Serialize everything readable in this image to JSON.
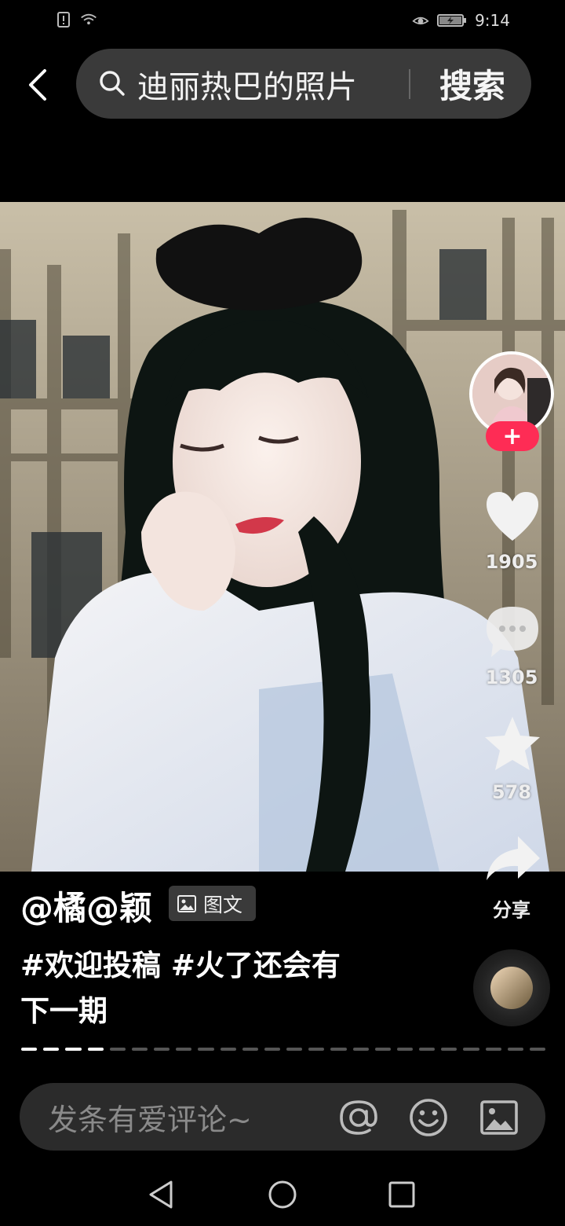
{
  "status_bar": {
    "time": "9:14",
    "icons": [
      "sim-alert-icon",
      "wifi-icon",
      "eye-comfort-icon",
      "battery-charging-icon"
    ]
  },
  "search": {
    "query": "迪丽热巴的照片",
    "button_label": "搜索"
  },
  "post": {
    "author": "@橘@颖",
    "type_badge": "图文",
    "caption_line1": "#欢迎投稿 #火了还会有",
    "caption_line2": "下一期",
    "progress_total": 24,
    "progress_done": 4
  },
  "actions": {
    "likes": "1905",
    "comments": "1305",
    "favorites": "578",
    "share_label": "分享",
    "follow_label": "+"
  },
  "comment_bar": {
    "placeholder": "发条有爱评论~"
  },
  "colors": {
    "accent": "#fe2c55",
    "background": "#000000",
    "search_bg": "#3a3a3a",
    "comment_bg": "#2b2b2b"
  }
}
